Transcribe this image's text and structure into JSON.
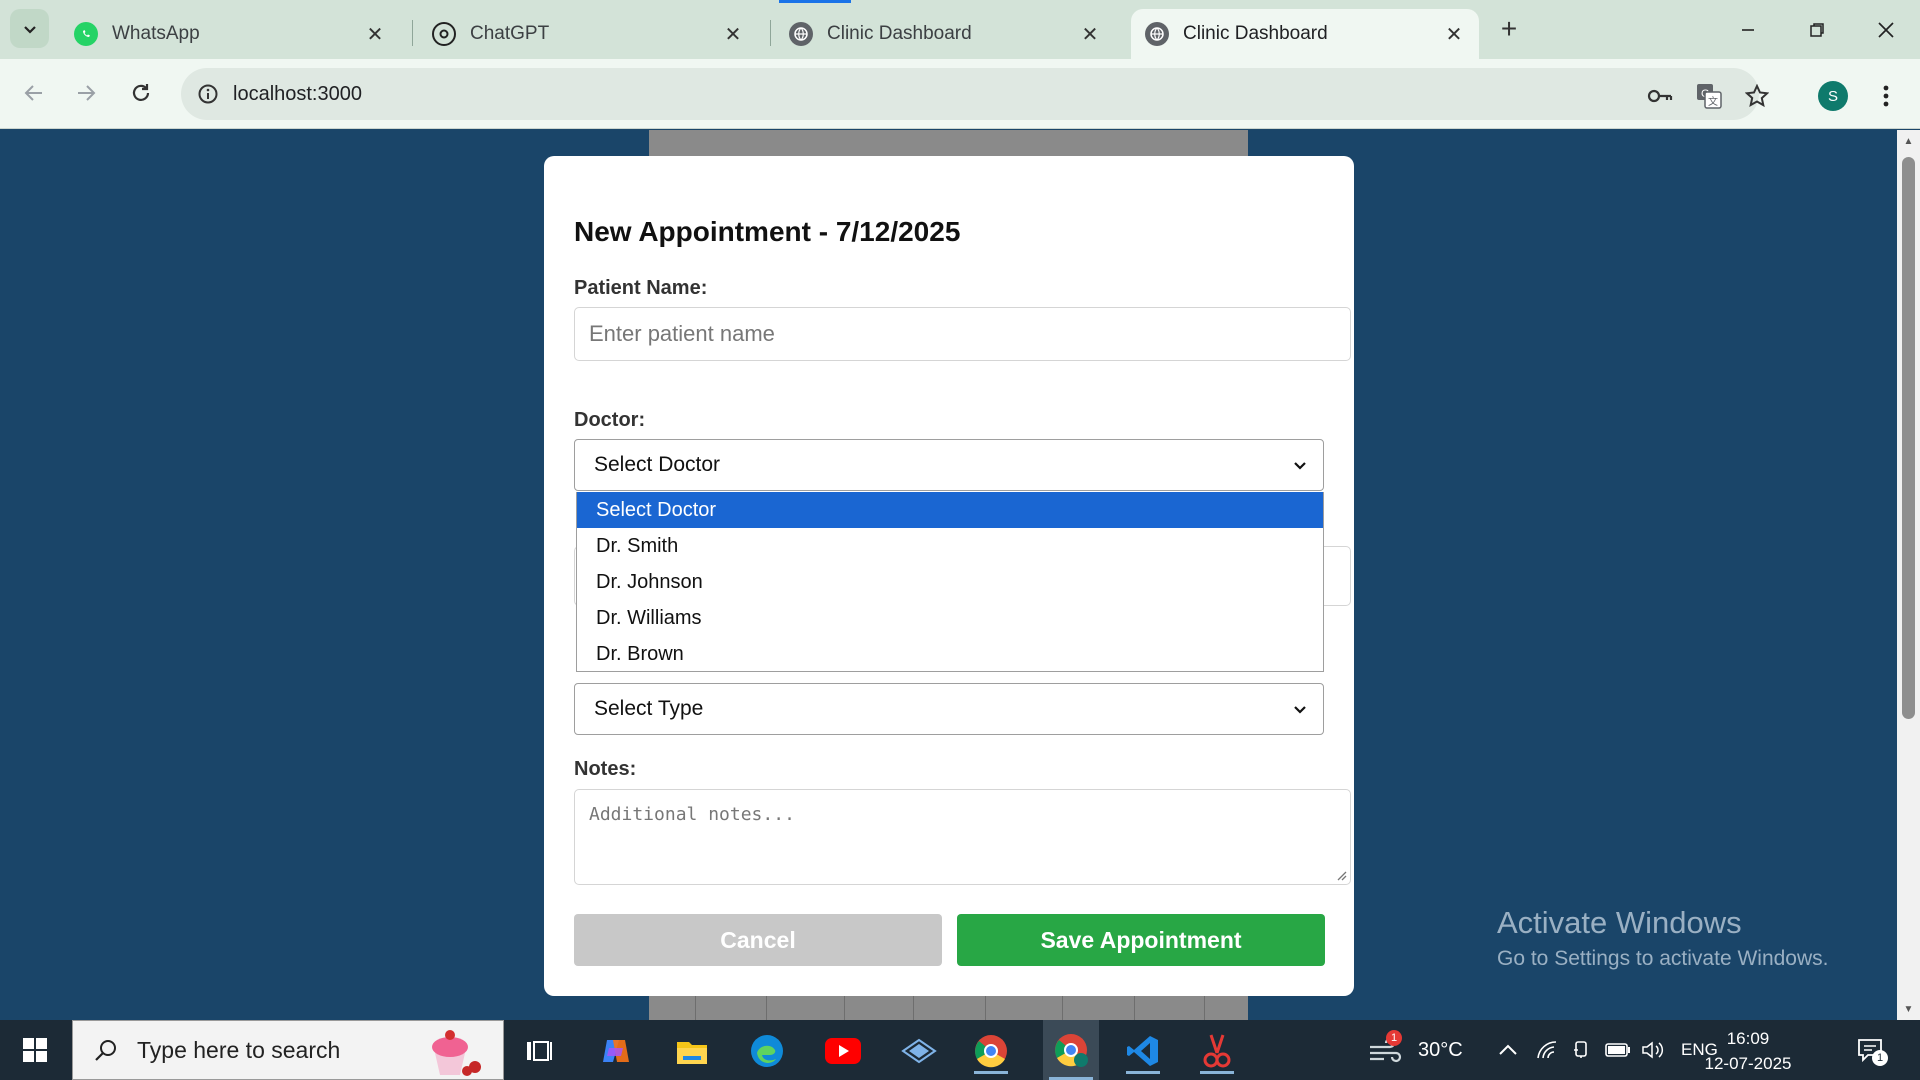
{
  "browser": {
    "tabs": [
      {
        "title": "WhatsApp",
        "icon": "whatsapp-icon",
        "active": false
      },
      {
        "title": "ChatGPT",
        "icon": "chatgpt-icon",
        "active": false
      },
      {
        "title": "Clinic Dashboard",
        "icon": "globe-icon",
        "active": false
      },
      {
        "title": "Clinic Dashboard",
        "icon": "globe-icon",
        "active": true
      }
    ],
    "address": "localhost:3000",
    "profile_initial": "S"
  },
  "modal": {
    "title": "New Appointment - 7/12/2025",
    "patient_label": "Patient Name:",
    "patient_placeholder": "Enter patient name",
    "doctor_label": "Doctor:",
    "doctor_selected": "Select Doctor",
    "doctor_options": [
      "Select Doctor",
      "Dr. Smith",
      "Dr. Johnson",
      "Dr. Williams",
      "Dr. Brown"
    ],
    "type_selected": "Select Type",
    "notes_label": "Notes:",
    "notes_placeholder": "Additional notes...",
    "cancel_label": "Cancel",
    "save_label": "Save Appointment"
  },
  "watermark": {
    "line1": "Activate Windows",
    "line2": "Go to Settings to activate Windows."
  },
  "taskbar": {
    "search_placeholder": "Type here to search",
    "weather_temp": "30°C",
    "weather_badge": "1",
    "language": "ENG",
    "time": "16:09",
    "date": "12-07-2025",
    "notification_count": "1"
  },
  "colors": {
    "page_bg": "#1a4569",
    "save_button": "#28a745",
    "cancel_button": "#c8c8c8",
    "dropdown_highlight": "#1a66d2"
  }
}
